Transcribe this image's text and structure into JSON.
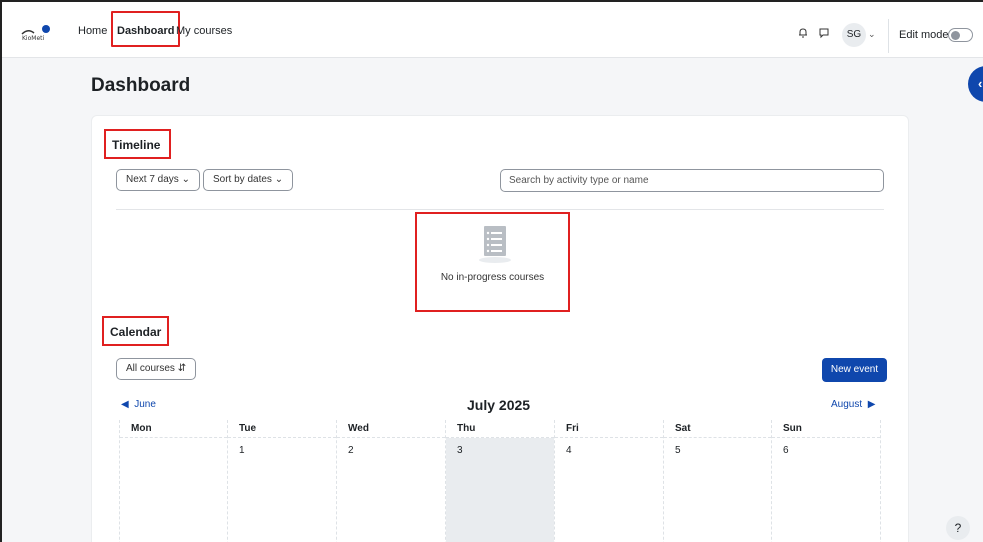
{
  "navbar": {
    "logo_text": "KioMeti",
    "links": [
      "Home",
      "Dashboard",
      "My courses"
    ],
    "user_initials": "SG",
    "edit_mode_label": "Edit mode"
  },
  "page": {
    "title": "Dashboard"
  },
  "timeline": {
    "heading": "Timeline",
    "filter_label": "Next 7 days",
    "sort_label": "Sort by dates",
    "search_placeholder": "Search by activity type or name",
    "empty_text": "No in-progress courses"
  },
  "calendar": {
    "heading": "Calendar",
    "course_filter": "All courses",
    "new_event_label": "New event",
    "prev_month": "June",
    "current_month": "July 2025",
    "next_month": "August",
    "weekdays": [
      "Mon",
      "Tue",
      "Wed",
      "Thu",
      "Fri",
      "Sat",
      "Sun"
    ],
    "first_week": [
      "",
      "1",
      "2",
      "3",
      "4",
      "5",
      "6"
    ],
    "today": "3"
  },
  "help_label": "?",
  "colors": {
    "brand": "#0f47ad",
    "highlight_box": "#e02020",
    "today_bg": "#e9ecef"
  }
}
